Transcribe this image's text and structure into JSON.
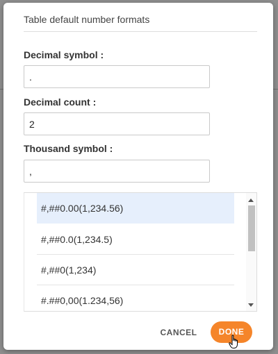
{
  "dialog": {
    "title": "Table default number formats"
  },
  "fields": {
    "decimal_symbol": {
      "label": "Decimal symbol :",
      "value": "."
    },
    "decimal_count": {
      "label": "Decimal count :",
      "value": "2"
    },
    "thousand_symbol": {
      "label": "Thousand symbol :",
      "value": ","
    }
  },
  "formats": {
    "items": [
      "#,##0.00(1,234.56)",
      "#,##0.0(1,234.5)",
      "#,##0(1,234)",
      "#.##0,00(1.234,56)"
    ],
    "selected_index": 0
  },
  "actions": {
    "cancel_label": "CANCEL",
    "done_label": "DONE"
  },
  "colors": {
    "accent": "#f5852a",
    "selected_row": "#e6effc"
  },
  "icons": {
    "cursor": "hand-pointer-icon",
    "scroll_up": "chevron-up-icon",
    "scroll_down": "chevron-down-icon"
  }
}
